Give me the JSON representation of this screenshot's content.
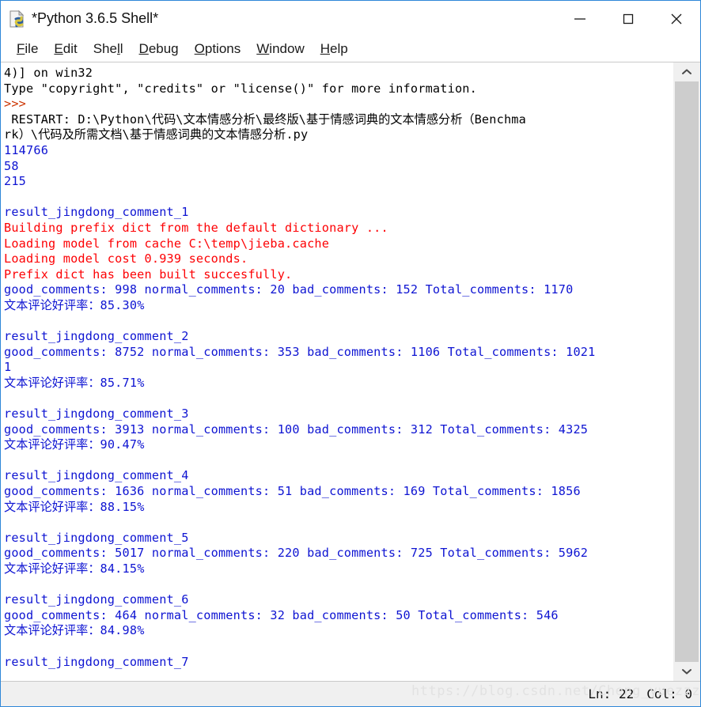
{
  "window": {
    "title": "*Python 3.6.5 Shell*",
    "icon": "python-file-icon",
    "controls": {
      "minimize": "minimize-button",
      "maximize": "maximize-button",
      "close": "close-button"
    }
  },
  "menubar": {
    "items": [
      {
        "label": "File",
        "pre": "",
        "mnemonic": "F",
        "post": "ile"
      },
      {
        "label": "Edit",
        "pre": "",
        "mnemonic": "E",
        "post": "dit"
      },
      {
        "label": "Shell",
        "pre": "She",
        "mnemonic": "l",
        "post": "l"
      },
      {
        "label": "Debug",
        "pre": "",
        "mnemonic": "D",
        "post": "ebug"
      },
      {
        "label": "Options",
        "pre": "",
        "mnemonic": "O",
        "post": "ptions"
      },
      {
        "label": "Window",
        "pre": "",
        "mnemonic": "W",
        "post": "indow"
      },
      {
        "label": "Help",
        "pre": "",
        "mnemonic": "H",
        "post": "elp"
      }
    ]
  },
  "console": {
    "lines": [
      {
        "text": "4)] on win32",
        "color": "black"
      },
      {
        "text": "Type \"copyright\", \"credits\" or \"license()\" for more information.",
        "color": "black"
      },
      {
        "text": ">>> ",
        "color": "prompt"
      },
      {
        "text": " RESTART: D:\\Python\\代码\\文本情感分析\\最终版\\基于情感词典的文本情感分析（Benchma",
        "color": "black"
      },
      {
        "text": "rk）\\代码及所需文档\\基于情感词典的文本情感分析.py",
        "color": "black"
      },
      {
        "text": "114766",
        "color": "blue"
      },
      {
        "text": "58",
        "color": "blue"
      },
      {
        "text": "215",
        "color": "blue"
      },
      {
        "text": "",
        "color": "blue"
      },
      {
        "text": "result_jingdong_comment_1",
        "color": "blue"
      },
      {
        "text": "Building prefix dict from the default dictionary ...",
        "color": "red"
      },
      {
        "text": "Loading model from cache C:\\temp\\jieba.cache",
        "color": "red"
      },
      {
        "text": "Loading model cost 0.939 seconds.",
        "color": "red"
      },
      {
        "text": "Prefix dict has been built succesfully.",
        "color": "red"
      },
      {
        "text": "good_comments: 998 normal_comments: 20 bad_comments: 152 Total_comments: 1170",
        "color": "blue"
      },
      {
        "text": "文本评论好评率：85.30%",
        "color": "blue"
      },
      {
        "text": "",
        "color": "blue"
      },
      {
        "text": "result_jingdong_comment_2",
        "color": "blue"
      },
      {
        "text": "good_comments: 8752 normal_comments: 353 bad_comments: 1106 Total_comments: 1021",
        "color": "blue"
      },
      {
        "text": "1",
        "color": "blue"
      },
      {
        "text": "文本评论好评率：85.71%",
        "color": "blue"
      },
      {
        "text": "",
        "color": "blue"
      },
      {
        "text": "result_jingdong_comment_3",
        "color": "blue"
      },
      {
        "text": "good_comments: 3913 normal_comments: 100 bad_comments: 312 Total_comments: 4325",
        "color": "blue"
      },
      {
        "text": "文本评论好评率：90.47%",
        "color": "blue"
      },
      {
        "text": "",
        "color": "blue"
      },
      {
        "text": "result_jingdong_comment_4",
        "color": "blue"
      },
      {
        "text": "good_comments: 1636 normal_comments: 51 bad_comments: 169 Total_comments: 1856",
        "color": "blue"
      },
      {
        "text": "文本评论好评率：88.15%",
        "color": "blue"
      },
      {
        "text": "",
        "color": "blue"
      },
      {
        "text": "result_jingdong_comment_5",
        "color": "blue"
      },
      {
        "text": "good_comments: 5017 normal_comments: 220 bad_comments: 725 Total_comments: 5962",
        "color": "blue"
      },
      {
        "text": "文本评论好评率：84.15%",
        "color": "blue"
      },
      {
        "text": "",
        "color": "blue"
      },
      {
        "text": "result_jingdong_comment_6",
        "color": "blue"
      },
      {
        "text": "good_comments: 464 normal_comments: 32 bad_comments: 50 Total_comments: 546",
        "color": "blue"
      },
      {
        "text": "文本评论好评率：84.98%",
        "color": "blue"
      },
      {
        "text": "",
        "color": "blue"
      },
      {
        "text": "result_jingdong_comment_7",
        "color": "blue"
      }
    ]
  },
  "scrollbar": {
    "up_arrow": "chevron-up-icon",
    "down_arrow": "chevron-down-icon"
  },
  "statusbar": {
    "line": "Ln: 22",
    "col": "Col: 0",
    "watermark": "https://blog.csdn.net/Cheng_yuezzz"
  },
  "colors": {
    "accent": "#2f87d8",
    "text_blue": "#0e14d2",
    "text_red": "#fd0104",
    "prompt": "#cc3300",
    "chrome": "#f0f0f0"
  }
}
